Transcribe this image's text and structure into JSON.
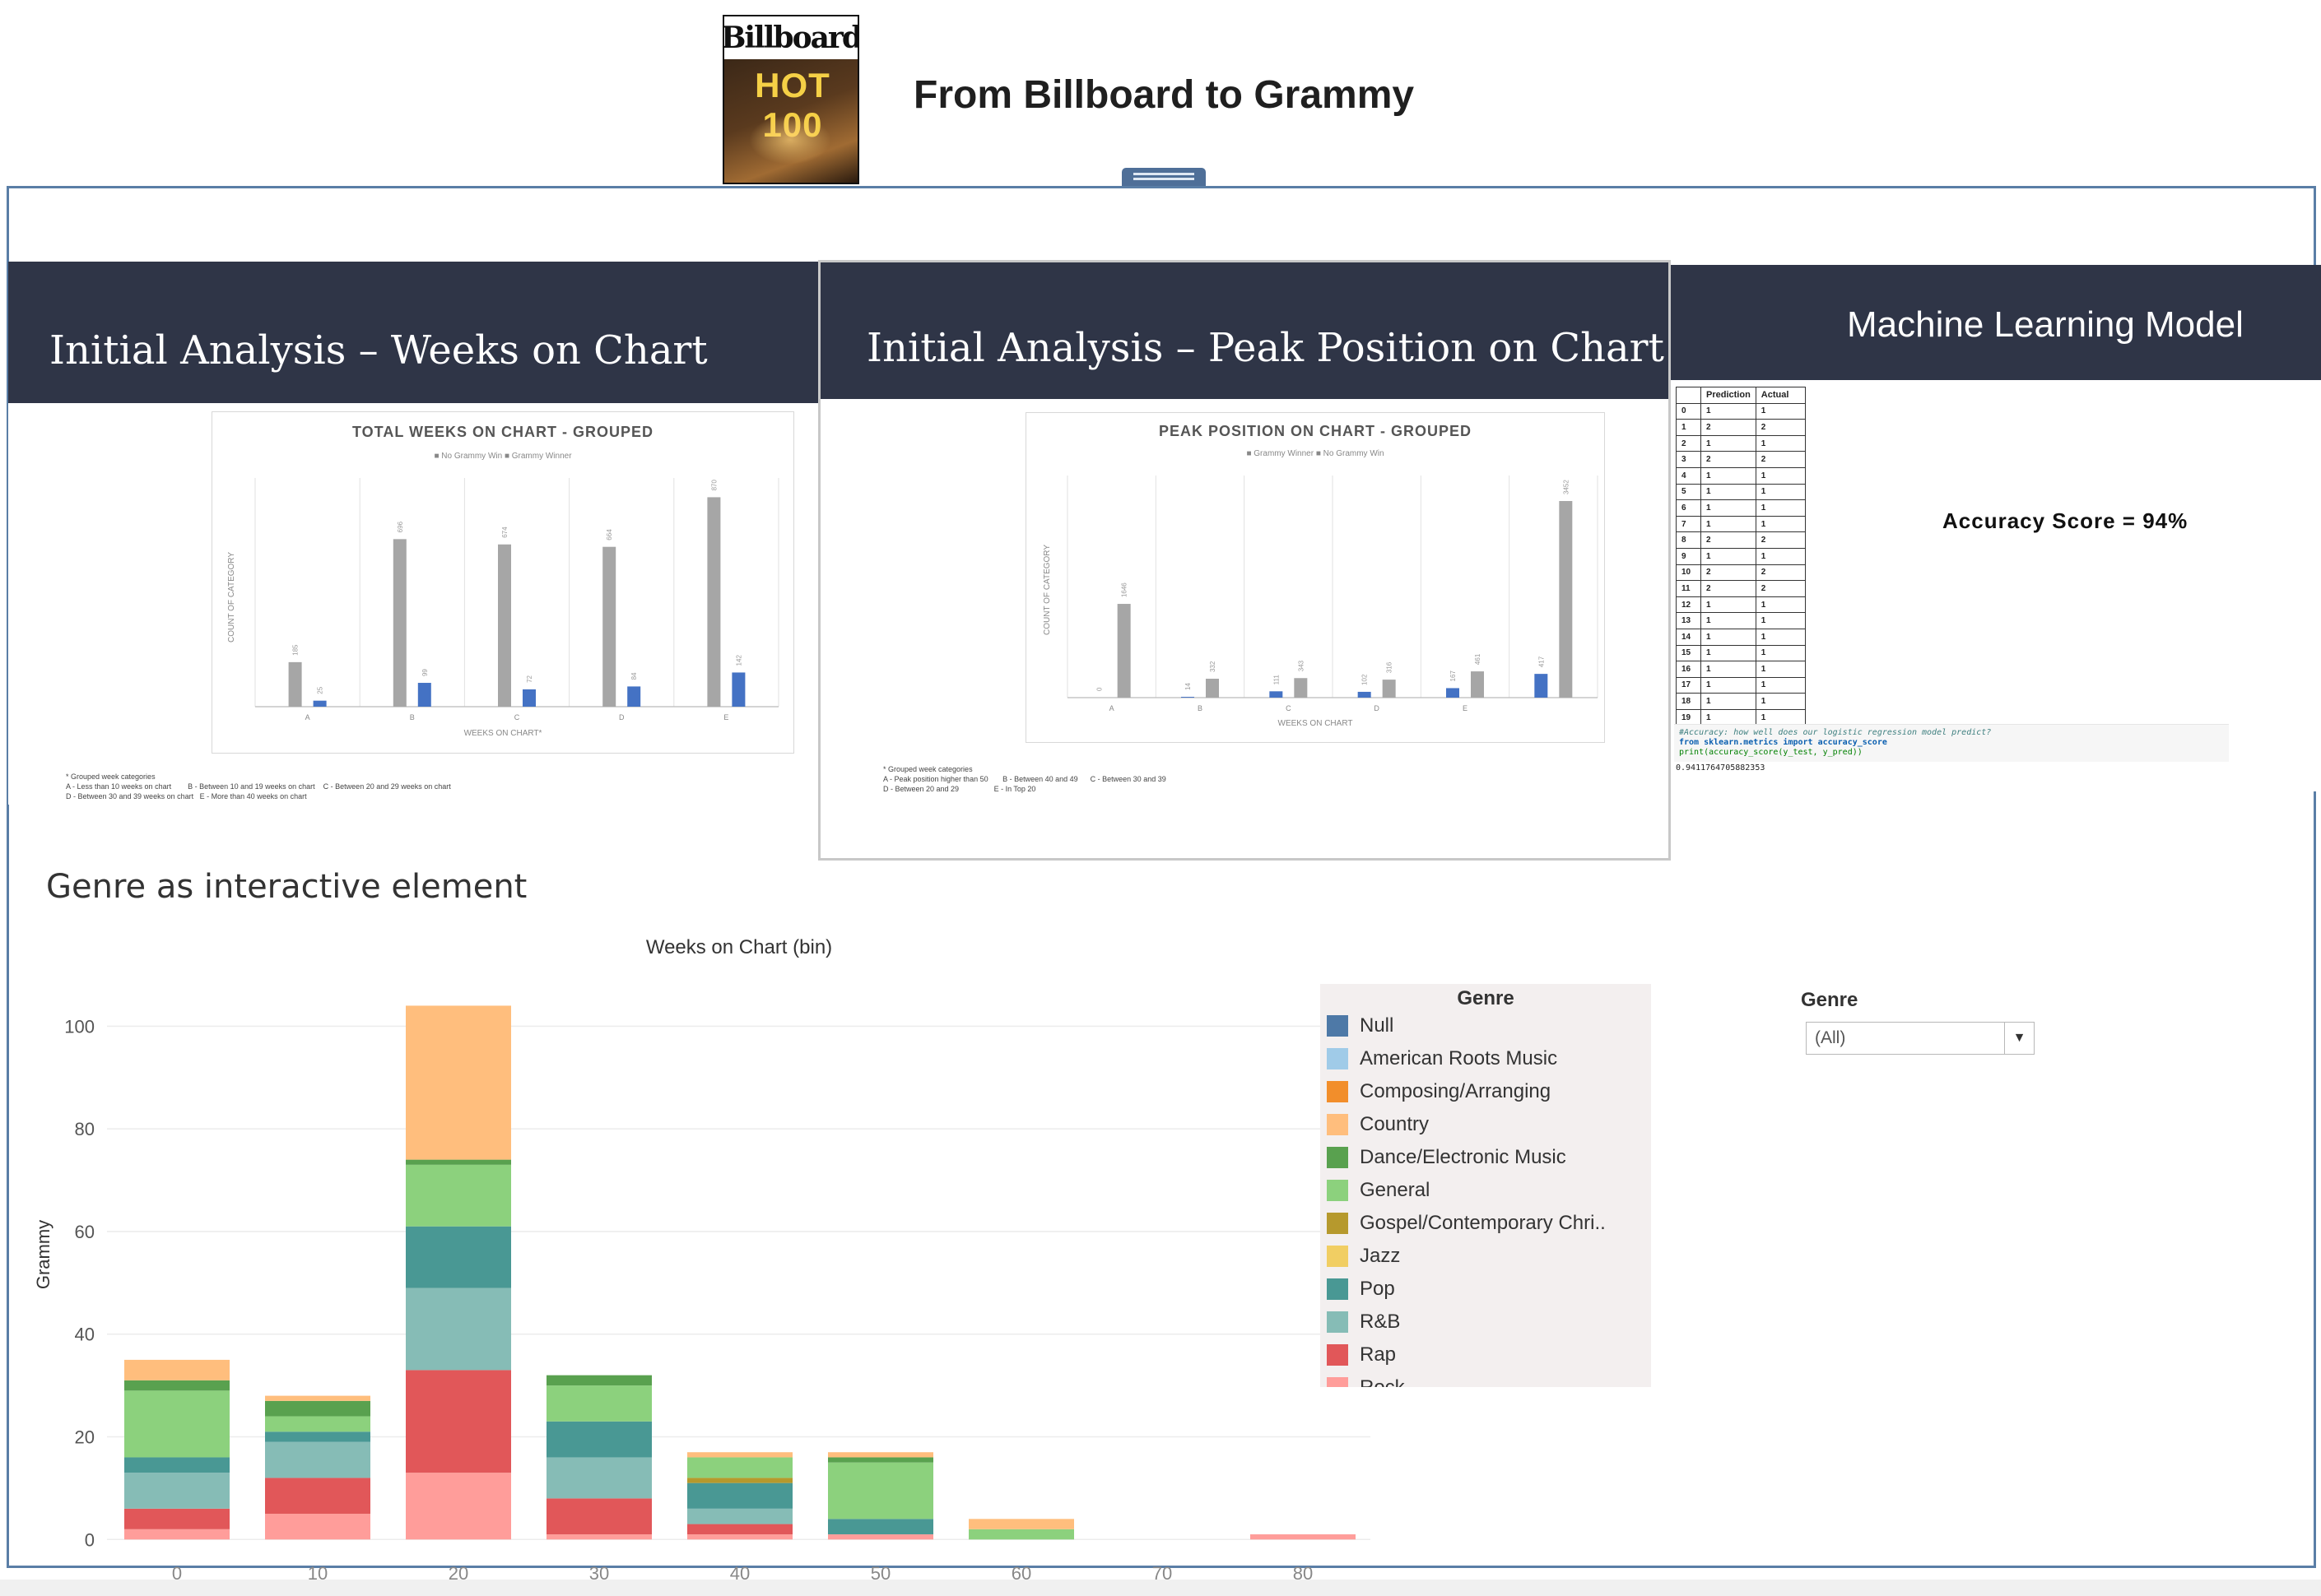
{
  "header": {
    "logo_top": "Billboard",
    "logo_hot": "HOT 100",
    "title": "From Billboard to Grammy"
  },
  "slides": {
    "weeks": {
      "title": "Initial Analysis – Weeks on Chart",
      "chart_title": "TOTAL WEEKS ON CHART - GROUPED",
      "legend": "■ No Grammy Win   ■ Grammy Winner",
      "ylabel": "COUNT OF CATEGORY",
      "xlabel": "WEEKS ON CHART*",
      "footnote": "* Grouped week categories\nA - Less than 10 weeks on chart        B - Between 10 and 19 weeks on chart    C - Between 20 and 29 weeks on chart\nD - Between 30 and 39 weeks on chart   E - More than 40 weeks on chart"
    },
    "peak": {
      "title": "Initial Analysis – Peak Position on Chart",
      "chart_title": "PEAK POSITION ON CHART - GROUPED",
      "legend": "■ Grammy Winner   ■ No Grammy Win",
      "ylabel": "COUNT OF CATEGORY",
      "xlabel": "WEEKS ON CHART",
      "footnote": "* Grouped week categories\nA - Peak position higher than 50       B - Between 40 and 49      C - Between 30 and 39\nD - Between 20 and 29                 E - In Top 20"
    },
    "ml": {
      "title": "Machine Learning Model",
      "accuracy": "Accuracy Score = 94%",
      "table_headers": [
        "",
        "Prediction",
        "Actual"
      ],
      "table_rows": [
        [
          "0",
          "1",
          "1"
        ],
        [
          "1",
          "2",
          "2"
        ],
        [
          "2",
          "1",
          "1"
        ],
        [
          "3",
          "2",
          "2"
        ],
        [
          "4",
          "1",
          "1"
        ],
        [
          "5",
          "1",
          "1"
        ],
        [
          "6",
          "1",
          "1"
        ],
        [
          "7",
          "1",
          "1"
        ],
        [
          "8",
          "2",
          "2"
        ],
        [
          "9",
          "1",
          "1"
        ],
        [
          "10",
          "2",
          "2"
        ],
        [
          "11",
          "2",
          "2"
        ],
        [
          "12",
          "1",
          "1"
        ],
        [
          "13",
          "1",
          "1"
        ],
        [
          "14",
          "1",
          "1"
        ],
        [
          "15",
          "1",
          "1"
        ],
        [
          "16",
          "1",
          "1"
        ],
        [
          "17",
          "1",
          "1"
        ],
        [
          "18",
          "1",
          "1"
        ],
        [
          "19",
          "1",
          "1"
        ]
      ],
      "code_line1": "#Accuracy: how well does our logistic regression model predict?",
      "code_line2": "from sklearn.metrics import accuracy_score",
      "code_line3": "print(accuracy_score(y_test, y_pred))",
      "code_output": "0.9411764705882353"
    }
  },
  "genre_section": {
    "title": "Genre as interactive element",
    "filter_label": "Genre",
    "filter_value": "(All)",
    "legend_title": "Genre",
    "legend_items": [
      {
        "name": "Null",
        "color": "#4e79a7"
      },
      {
        "name": "American Roots Music",
        "color": "#a0cbe8"
      },
      {
        "name": "Composing/Arranging",
        "color": "#f28e2b"
      },
      {
        "name": "Country",
        "color": "#ffbe7d"
      },
      {
        "name": "Dance/Electronic Music",
        "color": "#59a14f"
      },
      {
        "name": "General",
        "color": "#8cd17d"
      },
      {
        "name": "Gospel/Contemporary Chri..",
        "color": "#b6992d"
      },
      {
        "name": "Jazz",
        "color": "#f1ce63"
      },
      {
        "name": "Pop",
        "color": "#499894"
      },
      {
        "name": "R&B",
        "color": "#86bcb6"
      },
      {
        "name": "Rap",
        "color": "#e15759"
      },
      {
        "name": "Rock",
        "color": "#ff9d9a"
      }
    ]
  },
  "chart_data": [
    {
      "id": "weeks_on_chart_grouped",
      "type": "bar",
      "title": "TOTAL WEEKS ON CHART - GROUPED",
      "xlabel": "WEEKS ON CHART*",
      "ylabel": "COUNT OF CATEGORY",
      "categories": [
        "A",
        "B",
        "C",
        "D",
        "E"
      ],
      "series": [
        {
          "name": "No Grammy Win",
          "color": "#a6a6a6",
          "values": [
            185,
            696,
            674,
            664,
            870
          ]
        },
        {
          "name": "Grammy Winner",
          "color": "#4472c4",
          "values": [
            25,
            99,
            72,
            84,
            142
          ]
        }
      ],
      "ylim": [
        0,
        950
      ]
    },
    {
      "id": "peak_position_grouped",
      "type": "bar",
      "title": "PEAK POSITION ON CHART - GROUPED",
      "xlabel": "WEEKS ON CHART",
      "ylabel": "COUNT OF CATEGORY",
      "categories": [
        "A",
        "B",
        "C",
        "D",
        "E"
      ],
      "series": [
        {
          "name": "Grammy Winner",
          "color": "#4472c4",
          "values": [
            0,
            14,
            111,
            102,
            167,
            417
          ]
        },
        {
          "name": "No Grammy Win",
          "color": "#a6a6a6",
          "values": [
            1646,
            332,
            343,
            316,
            461,
            3452
          ]
        }
      ],
      "ylim": [
        0,
        3900
      ]
    },
    {
      "id": "genre_weeks_bin",
      "type": "bar",
      "stacked": true,
      "title": "Weeks on Chart (bin)",
      "xlabel": "",
      "ylabel": "Grammy",
      "categories": [
        0,
        10,
        20,
        30,
        40,
        50,
        60,
        70,
        80
      ],
      "yticks": [
        0,
        20,
        40,
        60,
        80,
        100
      ],
      "ylim": [
        -3,
        110
      ],
      "series": [
        {
          "name": "Rock",
          "color": "#ff9d9a",
          "values": [
            2,
            5,
            13,
            1,
            1,
            1,
            0,
            0,
            1
          ]
        },
        {
          "name": "Rap",
          "color": "#e15759",
          "values": [
            4,
            7,
            20,
            7,
            2,
            0,
            0,
            0,
            0
          ]
        },
        {
          "name": "R&B",
          "color": "#86bcb6",
          "values": [
            7,
            7,
            16,
            8,
            3,
            0,
            0,
            0,
            0
          ]
        },
        {
          "name": "Pop",
          "color": "#499894",
          "values": [
            3,
            2,
            12,
            7,
            5,
            3,
            0,
            0,
            0
          ]
        },
        {
          "name": "Gospel/Contemporary Chri..",
          "color": "#b6992d",
          "values": [
            0,
            0,
            0,
            0,
            1,
            0,
            0,
            0,
            0
          ]
        },
        {
          "name": "General",
          "color": "#8cd17d",
          "values": [
            13,
            3,
            12,
            7,
            4,
            11,
            2,
            0,
            0
          ]
        },
        {
          "name": "Dance/Electronic Music",
          "color": "#59a14f",
          "values": [
            2,
            3,
            1,
            2,
            0,
            1,
            0,
            0,
            0
          ]
        },
        {
          "name": "Country",
          "color": "#ffbe7d",
          "values": [
            4,
            1,
            30,
            0,
            1,
            1,
            2,
            0,
            0
          ]
        }
      ]
    }
  ]
}
